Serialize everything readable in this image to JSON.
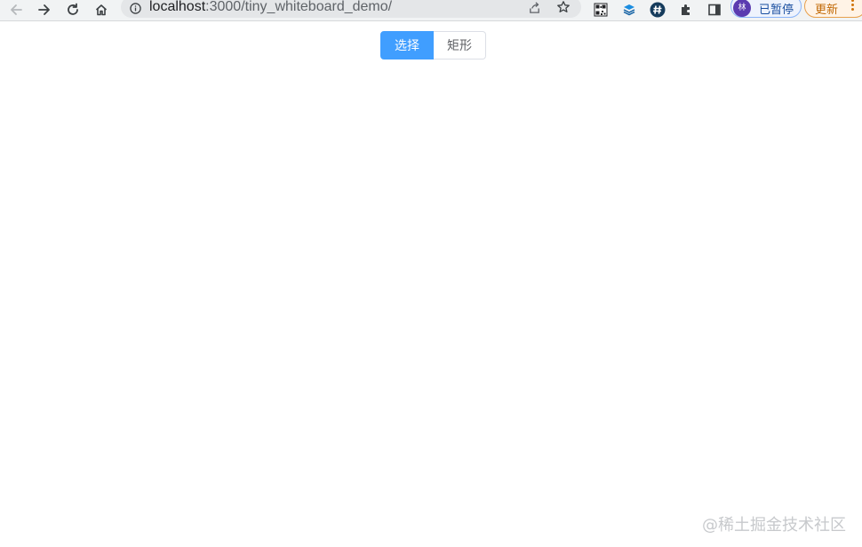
{
  "browser": {
    "url_host": "localhost",
    "url_path": ":3000/tiny_whiteboard_demo/",
    "profile": {
      "avatar_initial": "林",
      "label": "已暂停"
    },
    "update_label": "更新",
    "colors": {
      "toolbar_bg": "#f1f3f4",
      "omnibox_bg": "#e4e6e8",
      "avatar_bg": "#5b3bb0",
      "update_accent": "#e8a04c"
    }
  },
  "page": {
    "mode_buttons": [
      {
        "label": "选择",
        "active": true
      },
      {
        "label": "矩形",
        "active": false
      }
    ],
    "colors": {
      "primary": "#409eff",
      "border": "#dcdfe6",
      "text": "#606266"
    },
    "watermark": "@稀土掘金技术社区"
  },
  "icons": {
    "back": "arrow-left-icon",
    "forward": "arrow-right-icon",
    "reload": "reload-icon",
    "home": "home-icon",
    "site_info": "info-icon",
    "share": "share-icon",
    "bookmark": "star-icon",
    "extension_qr": "qr-code-icon",
    "extension_layers": "layers-icon",
    "extension_hash": "hash-icon",
    "extensions": "puzzle-icon",
    "side_panel": "side-panel-icon",
    "menu": "kebab-menu-icon"
  }
}
